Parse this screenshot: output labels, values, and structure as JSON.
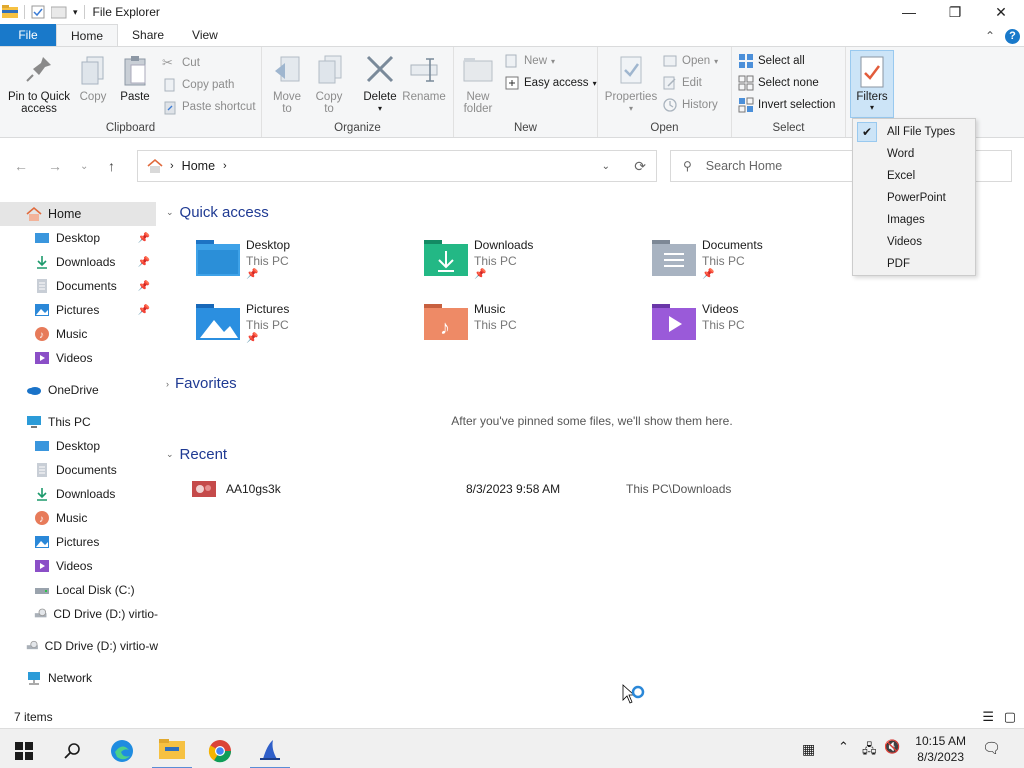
{
  "window": {
    "title": "File Explorer"
  },
  "tabs": {
    "file": "File",
    "home": "Home",
    "share": "Share",
    "view": "View"
  },
  "ribbon": {
    "clipboard": {
      "label": "Clipboard",
      "pin": "Pin to Quick access",
      "copy": "Copy",
      "paste": "Paste",
      "cut": "Cut",
      "copy_path": "Copy path",
      "paste_shortcut": "Paste shortcut"
    },
    "organize": {
      "label": "Organize",
      "move_to": "Move to",
      "copy_to": "Copy to",
      "delete": "Delete",
      "rename": "Rename"
    },
    "new": {
      "label": "New",
      "new_folder": "New folder",
      "new_item": "New",
      "easy_access": "Easy access"
    },
    "open": {
      "label": "Open",
      "properties": "Properties",
      "open": "Open",
      "edit": "Edit",
      "history": "History"
    },
    "select": {
      "label": "Select",
      "select_all": "Select all",
      "select_none": "Select none",
      "invert": "Invert selection"
    },
    "filters": "Filters"
  },
  "filters_menu": {
    "items": [
      "All File Types",
      "Word",
      "Excel",
      "PowerPoint",
      "Images",
      "Videos",
      "PDF"
    ],
    "checked": "All File Types"
  },
  "address": {
    "crumb": "Home",
    "search_placeholder": "Search Home"
  },
  "sidebar": {
    "home": "Home",
    "quick": [
      "Desktop",
      "Downloads",
      "Documents",
      "Pictures",
      "Music",
      "Videos"
    ],
    "onedrive": "OneDrive",
    "thispc": "This PC",
    "pc_items": [
      "Desktop",
      "Documents",
      "Downloads",
      "Music",
      "Pictures",
      "Videos",
      "Local Disk (C:)",
      "CD Drive (D:) virtio-"
    ],
    "cd_drive": "CD Drive (D:) virtio-w",
    "network": "Network"
  },
  "content": {
    "quick_access": "Quick access",
    "tiles": [
      {
        "name": "Desktop",
        "sub": "This PC"
      },
      {
        "name": "Downloads",
        "sub": "This PC"
      },
      {
        "name": "Documents",
        "sub": "This PC"
      },
      {
        "name": "Pictures",
        "sub": "This PC"
      },
      {
        "name": "Music",
        "sub": "This PC"
      },
      {
        "name": "Videos",
        "sub": "This PC"
      }
    ],
    "favorites": "Favorites",
    "favorites_empty": "After you've pinned some files, we'll show them here.",
    "recent": "Recent",
    "recent_items": [
      {
        "name": "AA10gs3k",
        "date": "8/3/2023 9:58 AM",
        "location": "This PC\\Downloads"
      }
    ]
  },
  "status": {
    "items": "7 items"
  },
  "taskbar": {
    "time": "10:15 AM",
    "date": "8/3/2023"
  }
}
